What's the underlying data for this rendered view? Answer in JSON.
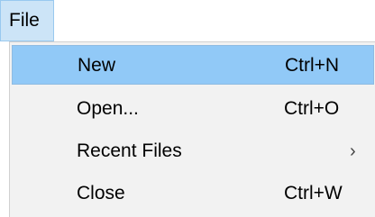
{
  "menubar": {
    "active_menu": "File"
  },
  "dropdown": {
    "items": [
      {
        "label": "New",
        "shortcut": "Ctrl+N",
        "selected": true
      },
      {
        "label": "Open...",
        "shortcut": "Ctrl+O",
        "selected": false
      },
      {
        "label": "Recent Files",
        "shortcut": "",
        "submenu_glyph": "›",
        "selected": false
      },
      {
        "label": "Close",
        "shortcut": "Ctrl+W",
        "selected": false
      }
    ]
  },
  "colors": {
    "highlight": "#91c9f7",
    "menu_background": "#f2f2f2",
    "menu_title_background": "#cce4f7"
  },
  "icons": {
    "submenu": "chevron-right-icon"
  }
}
